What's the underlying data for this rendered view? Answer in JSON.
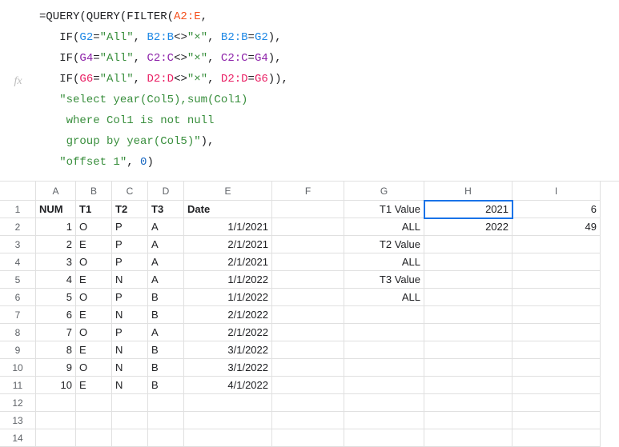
{
  "formula": {
    "line1_a": "=QUERY(QUERY(FILTER(",
    "line1_range": "A2:E",
    "line1_b": ",",
    "line2_a": "   IF(",
    "line2_r1": "G2",
    "line2_b": "=",
    "line2_s1": "\"All\"",
    "line2_c": ", ",
    "line2_r2": "B2:B",
    "line2_d": "<>",
    "line2_s2": "\"×\"",
    "line2_e": ", ",
    "line2_r3": "B2:B",
    "line2_f": "=",
    "line2_r4": "G2",
    "line2_g": "),",
    "line3_a": "   IF(",
    "line3_r1": "G4",
    "line3_b": "=",
    "line3_s1": "\"All\"",
    "line3_c": ", ",
    "line3_r2": "C2:C",
    "line3_d": "<>",
    "line3_s2": "\"×\"",
    "line3_e": ", ",
    "line3_r3": "C2:C",
    "line3_f": "=",
    "line3_r4": "G4",
    "line3_g": "),",
    "line4_a": "   IF(",
    "line4_r1": "G6",
    "line4_b": "=",
    "line4_s1": "\"All\"",
    "line4_c": ", ",
    "line4_r2": "D2:D",
    "line4_d": "<>",
    "line4_s2": "\"×\"",
    "line4_e": ", ",
    "line4_r3": "D2:D",
    "line4_f": "=",
    "line4_r4": "G6",
    "line4_g": ")),",
    "line5": "   \"select year(Col5),sum(Col1)",
    "line6": "    where Col1 is not null",
    "line7_a": "    group by year(Col5)\"",
    "line7_b": "),",
    "line8_a": "   ",
    "line8_s": "\"offset 1\"",
    "line8_b": ", ",
    "line8_n": "0",
    "line8_c": ")"
  },
  "colHeaders": [
    "A",
    "B",
    "C",
    "D",
    "E",
    "F",
    "G",
    "H",
    "I"
  ],
  "rowHeaders": [
    "1",
    "2",
    "3",
    "4",
    "5",
    "6",
    "7",
    "8",
    "9",
    "10",
    "11",
    "12",
    "13",
    "14"
  ],
  "headerRow": {
    "A": "NUM",
    "B": "T1",
    "C": "T2",
    "D": "T3",
    "E": "Date"
  },
  "gcol": [
    "T1 Value",
    "ALL",
    "T2 Value",
    "ALL",
    "T3 Value",
    "ALL"
  ],
  "hcol": [
    "2021",
    "2022"
  ],
  "icol": [
    "6",
    "49"
  ],
  "rows": [
    {
      "n": "1",
      "t1": "O",
      "t2": "P",
      "t3": "A",
      "d": "1/1/2021"
    },
    {
      "n": "2",
      "t1": "E",
      "t2": "P",
      "t3": "A",
      "d": "2/1/2021"
    },
    {
      "n": "3",
      "t1": "O",
      "t2": "P",
      "t3": "A",
      "d": "2/1/2021"
    },
    {
      "n": "4",
      "t1": "E",
      "t2": "N",
      "t3": "A",
      "d": "1/1/2022"
    },
    {
      "n": "5",
      "t1": "O",
      "t2": "P",
      "t3": "B",
      "d": "1/1/2022"
    },
    {
      "n": "6",
      "t1": "E",
      "t2": "N",
      "t3": "B",
      "d": "2/1/2022"
    },
    {
      "n": "7",
      "t1": "O",
      "t2": "P",
      "t3": "A",
      "d": "2/1/2022"
    },
    {
      "n": "8",
      "t1": "E",
      "t2": "N",
      "t3": "B",
      "d": "3/1/2022"
    },
    {
      "n": "9",
      "t1": "O",
      "t2": "N",
      "t3": "B",
      "d": "3/1/2022"
    },
    {
      "n": "10",
      "t1": "E",
      "t2": "N",
      "t3": "B",
      "d": "4/1/2022"
    }
  ]
}
